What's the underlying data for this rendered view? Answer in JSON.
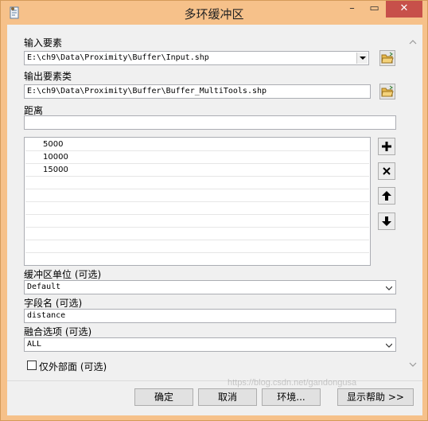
{
  "window": {
    "title": "多环缓冲区",
    "minimize_glyph": "–",
    "maximize_glyph": "▭",
    "close_glyph": "✕"
  },
  "form": {
    "input_label": "输入要素",
    "input_value": "E:\\ch9\\Data\\Proximity\\Buffer\\Input.shp",
    "output_label": "输出要素类",
    "output_value": "E:\\ch9\\Data\\Proximity\\Buffer\\Buffer_MultiTools.shp",
    "distance_label": "距离",
    "distance_value": "",
    "distances": [
      "5000",
      "10000",
      "15000"
    ],
    "unit_label": "缓冲区单位 (可选)",
    "unit_value": "Default",
    "field_label": "字段名 (可选)",
    "field_value": "distance",
    "dissolve_label": "融合选项 (可选)",
    "dissolve_value": "ALL",
    "outside_label": "仅外部面 (可选)"
  },
  "buttons": {
    "ok": "确定",
    "cancel": "取消",
    "env": "环境...",
    "help": "显示帮助 >>"
  },
  "icons": {
    "add": "+",
    "remove": "✕",
    "up": "↑",
    "down": "↓"
  },
  "watermark": "https://blog.csdn.net/gandongusa"
}
